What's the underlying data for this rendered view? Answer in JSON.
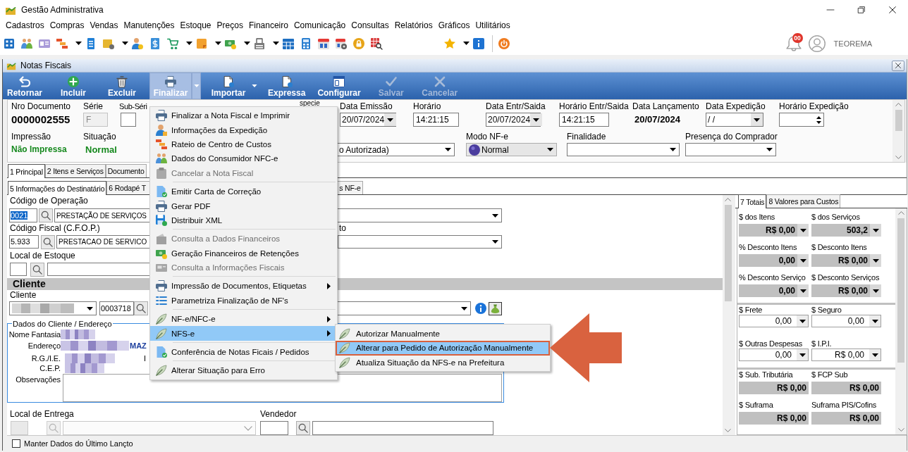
{
  "app_window": {
    "title": "Gestão Administrativa"
  },
  "menu_bar": [
    "Cadastros",
    "Compras",
    "Vendas",
    "Manutenções",
    "Estoque",
    "Preços",
    "Financeiro",
    "Comunicação",
    "Consultas",
    "Relatórios",
    "Gráficos",
    "Utilitários"
  ],
  "top_toolbar": {
    "notification_count": "00",
    "user_name": "TEOREMA"
  },
  "child_window": {
    "title": "Notas Fiscais"
  },
  "action_toolbar": [
    {
      "label": "Retornar",
      "disabled": false,
      "dropdown": false,
      "expanded": false
    },
    {
      "label": "Incluir",
      "disabled": false,
      "dropdown": false,
      "expanded": false
    },
    {
      "label": "Excluir",
      "disabled": false,
      "dropdown": false,
      "expanded": false
    },
    {
      "label": "Finalizar",
      "disabled": false,
      "dropdown": true,
      "expanded": true,
      "menu": [
        [
          {
            "label": "Finalizar a Nota Fiscal e Imprimir",
            "disabled": false,
            "selected": false,
            "submenu": false
          },
          {
            "label": "Informações da Expedição",
            "disabled": false,
            "selected": false,
            "submenu": false
          },
          {
            "label": "Rateio de Centro de Custos",
            "disabled": false,
            "selected": false,
            "submenu": false
          },
          {
            "label": "Dados do Consumidor NFC-e",
            "disabled": false,
            "selected": false,
            "submenu": false
          },
          {
            "label": "Cancelar a Nota Fiscal",
            "disabled": true,
            "selected": false,
            "submenu": false
          }
        ],
        [
          {
            "label": "Emitir Carta de Correção",
            "disabled": false,
            "selected": false,
            "submenu": false
          },
          {
            "label": "Gerar PDF",
            "disabled": false,
            "selected": false,
            "submenu": false
          },
          {
            "label": "Distribuir XML",
            "disabled": false,
            "selected": false,
            "submenu": false
          }
        ],
        [
          {
            "label": "Consulta a Dados Financeiros",
            "disabled": true,
            "selected": false,
            "submenu": false
          },
          {
            "label": "Geração Financeiros de Retenções",
            "disabled": false,
            "selected": false,
            "submenu": false
          },
          {
            "label": "Consulta a Informações Fiscais",
            "disabled": true,
            "selected": false,
            "submenu": false
          }
        ],
        [
          {
            "label": "Impressão de Documentos, Etiquetas",
            "disabled": false,
            "selected": false,
            "submenu": true
          },
          {
            "label": "Parametriza Finalização de NF's",
            "disabled": false,
            "selected": false,
            "submenu": false
          }
        ],
        [
          {
            "label": "NF-e/NFC-e",
            "disabled": false,
            "selected": false,
            "submenu": true
          },
          {
            "label": "NFS-e",
            "disabled": false,
            "selected": true,
            "submenu": true,
            "children": [
              {
                "label": "Autorizar Manualmente",
                "selected": false,
                "annotated": false
              },
              {
                "label": "Alterar para Pedido de Autorização Manualmente",
                "selected": true,
                "annotated": true
              },
              {
                "label": "Atualiza Situação da NFS-e na Prefeitura",
                "selected": false,
                "annotated": false
              }
            ]
          }
        ],
        [
          {
            "label": "Conferência de Notas Ficais / Pedidos",
            "disabled": false,
            "selected": false,
            "submenu": false
          }
        ],
        [
          {
            "label": "Alterar Situação para Erro",
            "disabled": false,
            "selected": false,
            "submenu": false
          }
        ]
      ]
    },
    {
      "label": "Importar",
      "disabled": false,
      "dropdown": true,
      "expanded": false
    },
    {
      "label": "Expressa",
      "disabled": false,
      "dropdown": false,
      "expanded": false
    },
    {
      "label": "Configurar",
      "disabled": false,
      "dropdown": false,
      "expanded": false
    },
    {
      "label": "Salvar",
      "disabled": true,
      "dropdown": false,
      "expanded": false
    },
    {
      "label": "Cancelar",
      "disabled": true,
      "dropdown": false,
      "expanded": false
    }
  ],
  "header": {
    "document_number": {
      "label": "Nro Documento",
      "value": "0000002555"
    },
    "series": {
      "label": "Série",
      "value": "F",
      "disabled": true
    },
    "sub_series": {
      "label": "Sub-Séri"
    },
    "species": {
      "label": "specie"
    },
    "issue_date": {
      "label": "Data Emissão",
      "value": "20/07/2024"
    },
    "issue_time": {
      "label": "Horário",
      "value": "14:21:15"
    },
    "entry_date": {
      "label": "Data Entr/Saida",
      "value": "20/07/2024"
    },
    "entry_time": {
      "label": "Horário Entr/Saida",
      "value": "14:21:15"
    },
    "posting_date": {
      "label": "Data Lançamento",
      "value": "20/07/2024"
    },
    "shipping_date": {
      "label": "Data Expedição",
      "value": "/ /"
    },
    "shipping_time": {
      "label": "Horário Expedição"
    },
    "printing": {
      "label": "Impressão",
      "value": "Não Impressa"
    },
    "status": {
      "label": "Situação",
      "value": "Normal"
    },
    "authorization": {
      "value": "o Autorizada)"
    },
    "nfe_mode": {
      "label": "Modo NF-e",
      "value": "Normal"
    },
    "purpose": {
      "label": "Finalidade"
    },
    "buyer_presence": {
      "label": "Presença do Comprador"
    }
  },
  "tabs": [
    {
      "label": "1 Principal",
      "selected": true
    },
    {
      "label": "2 Itens e Serviços",
      "selected": false
    },
    {
      "label": "Documento",
      "selected": false
    }
  ],
  "subtabs": [
    {
      "label": "5 Informações do Destinatário",
      "selected": true
    },
    {
      "label": "6 Rodapé T",
      "selected": false
    },
    {
      "label": "s NF-e",
      "selected": false
    }
  ],
  "recipient": {
    "operation": {
      "label": "Código de Operação",
      "code": "0021",
      "code_selected": true,
      "description": "PRESTAÇÃO DE SERVIÇOS"
    },
    "cfop": {
      "label": "Código Fiscal (C.F.O.P.)",
      "code": "5.933",
      "description": "PRESTACAO DE SERVICO"
    },
    "field_3": {
      "label": "to"
    },
    "stock_location": {
      "label": "Local de Estoque"
    },
    "client_section": {
      "title": "Cliente"
    },
    "client": {
      "label": "Cliente",
      "name_redacted": true,
      "code": "0003718"
    },
    "address_group": {
      "title": "Dados do Cliente / Endereço",
      "rows": [
        {
          "label": "Nome Fantasia",
          "redacted": true
        },
        {
          "label": "Endereço",
          "redacted": true,
          "value": "MAZ"
        },
        {
          "label": "R.G./I.E.",
          "redacted": true,
          "side_label": "I"
        },
        {
          "label": "C.E.P.",
          "redacted": true
        }
      ],
      "notes": {
        "label": "Observações"
      }
    },
    "delivery_location": {
      "label": "Local de Entrega",
      "disabled": true
    },
    "seller": {
      "label": "Vendedor"
    }
  },
  "totals": {
    "tabs": [
      {
        "label": "7 Totais",
        "selected": true
      },
      {
        "label": "8 Valores para Custos",
        "selected": false
      }
    ],
    "sections": [
      [
        {
          "label": "$ dos Itens",
          "value": "R$ 0,00",
          "readonly": true,
          "dropdown": true
        },
        {
          "label": "$ dos Serviços",
          "value": "503,2",
          "readonly": true,
          "dropdown": true
        },
        {
          "label": "% Desconto Itens",
          "value": "0,00",
          "readonly": true,
          "dropdown": true
        },
        {
          "label": "$ Desconto Itens",
          "value": "R$ 0,00",
          "readonly": true,
          "dropdown": true
        },
        {
          "label": "% Desconto Serviço",
          "value": "0,00",
          "readonly": true,
          "dropdown": true
        },
        {
          "label": "$ Desconto Serviços",
          "value": "R$ 0,00",
          "readonly": true,
          "dropdown": true
        }
      ],
      [
        {
          "label": "$ Frete",
          "value": "0,00",
          "readonly": false,
          "dropdown": true
        },
        {
          "label": "$ Seguro",
          "value": "0,00",
          "readonly": false,
          "dropdown": true
        },
        {
          "label": "$ Outras Despesas",
          "value": "0,00",
          "readonly": false,
          "dropdown": true
        },
        {
          "label": "$ I.P.I.",
          "value": "R$ 0,00",
          "readonly": false,
          "dropdown": true
        }
      ],
      [
        {
          "label": "$ Sub. Tributária",
          "value": "R$ 0,00",
          "readonly": true,
          "dropdown": false
        },
        {
          "label": "$ FCP Sub",
          "value": "R$ 0,00",
          "readonly": true,
          "dropdown": false
        },
        {
          "label": "$ Suframa",
          "value": "R$ 0,00",
          "readonly": true,
          "dropdown": false
        },
        {
          "label": "Suframa PIS/Cofins",
          "value": "R$ 0,00",
          "readonly": true,
          "dropdown": false
        }
      ]
    ]
  },
  "keep_data": {
    "label": "Manter Dados do Último Lançto",
    "checked": false
  }
}
